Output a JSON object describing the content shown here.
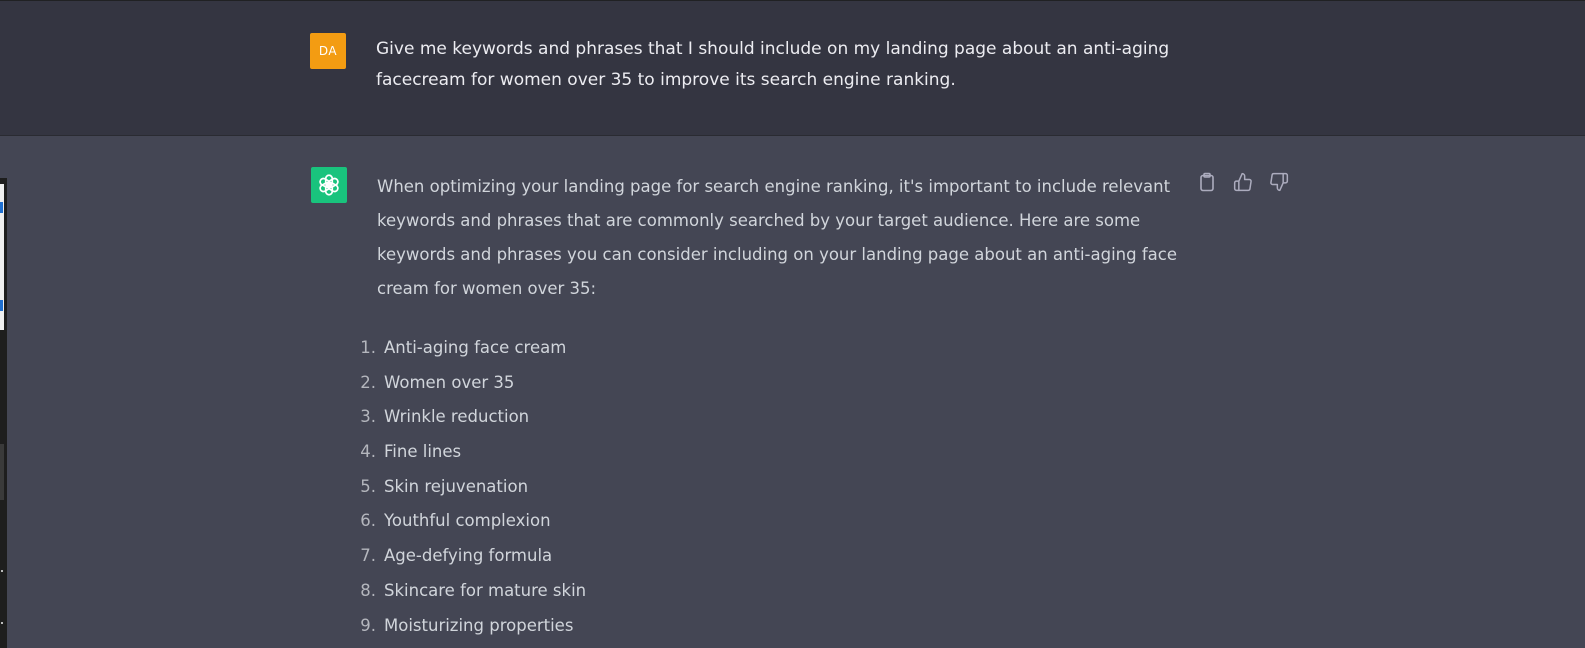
{
  "user_message": {
    "avatar_initials": "DA",
    "avatar_color": "#f39c12",
    "text": "Give me keywords and phrases that I should include on my landing page about an anti-aging facecream for women over 35 to improve its search engine ranking."
  },
  "assistant_message": {
    "avatar_icon": "openai-logo-icon",
    "avatar_color": "#19c37d",
    "intro": "When optimizing your landing page for search engine ranking, it's important to include relevant keywords and phrases that are commonly searched by your target audience. Here are some keywords and phrases you can consider including on your landing page about an anti-aging face cream for women over 35:",
    "list": [
      {
        "num": "1.",
        "text": "Anti-aging face cream"
      },
      {
        "num": "2.",
        "text": "Women over 35"
      },
      {
        "num": "3.",
        "text": "Wrinkle reduction"
      },
      {
        "num": "4.",
        "text": "Fine lines"
      },
      {
        "num": "5.",
        "text": "Skin rejuvenation"
      },
      {
        "num": "6.",
        "text": "Youthful complexion"
      },
      {
        "num": "7.",
        "text": "Age-defying formula"
      },
      {
        "num": "8.",
        "text": "Skincare for mature skin"
      },
      {
        "num": "9.",
        "text": "Moisturizing properties"
      }
    ],
    "actions": [
      {
        "name": "copy-button",
        "icon": "clipboard-icon"
      },
      {
        "name": "thumbs-up-button",
        "icon": "thumbs-up-icon"
      },
      {
        "name": "thumbs-down-button",
        "icon": "thumbs-down-icon"
      }
    ]
  },
  "colors": {
    "user_bg": "#343541",
    "assistant_bg": "#444654",
    "text": "#d1d5db",
    "icon": "#acacbe"
  }
}
